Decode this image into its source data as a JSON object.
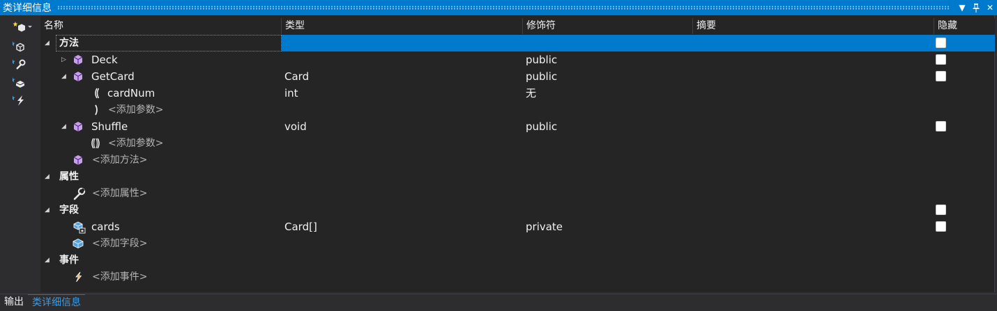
{
  "window": {
    "title": "类详细信息"
  },
  "columns": {
    "name": "名称",
    "type": "类型",
    "modifier": "修饰符",
    "summary": "摘要",
    "hide": "隐藏"
  },
  "rows": {
    "methods_group": "方法",
    "deck": {
      "name": "Deck",
      "type": "",
      "modifier": "public"
    },
    "getcard": {
      "name": "GetCard",
      "type": "Card",
      "modifier": "public"
    },
    "cardnum": {
      "name": "cardNum",
      "type": "int",
      "modifier": "无"
    },
    "add_param_1": "<添加参数>",
    "shuffle": {
      "name": "Shuffle",
      "type": "void",
      "modifier": "public"
    },
    "add_param_2": "<添加参数>",
    "add_method": "<添加方法>",
    "properties_group": "属性",
    "add_property": "<添加属性>",
    "fields_group": "字段",
    "cards": {
      "name": "cards",
      "type": "Card[]",
      "modifier": "private"
    },
    "add_field": "<添加字段>",
    "events_group": "事件",
    "add_event": "<添加事件>"
  },
  "tabs": {
    "output": "输出",
    "class_details": "类详细信息"
  },
  "colors": {
    "accent": "#007acc",
    "background": "#252526",
    "method_icon": "#c8a2e8",
    "field_icon": "#4fa3e0",
    "event_icon": "#f0a030"
  },
  "icons": [
    "new-member-icon",
    "method-icon",
    "property-icon",
    "field-icon",
    "event-icon",
    "parameter-icon",
    "pin-icon",
    "close-icon"
  ]
}
